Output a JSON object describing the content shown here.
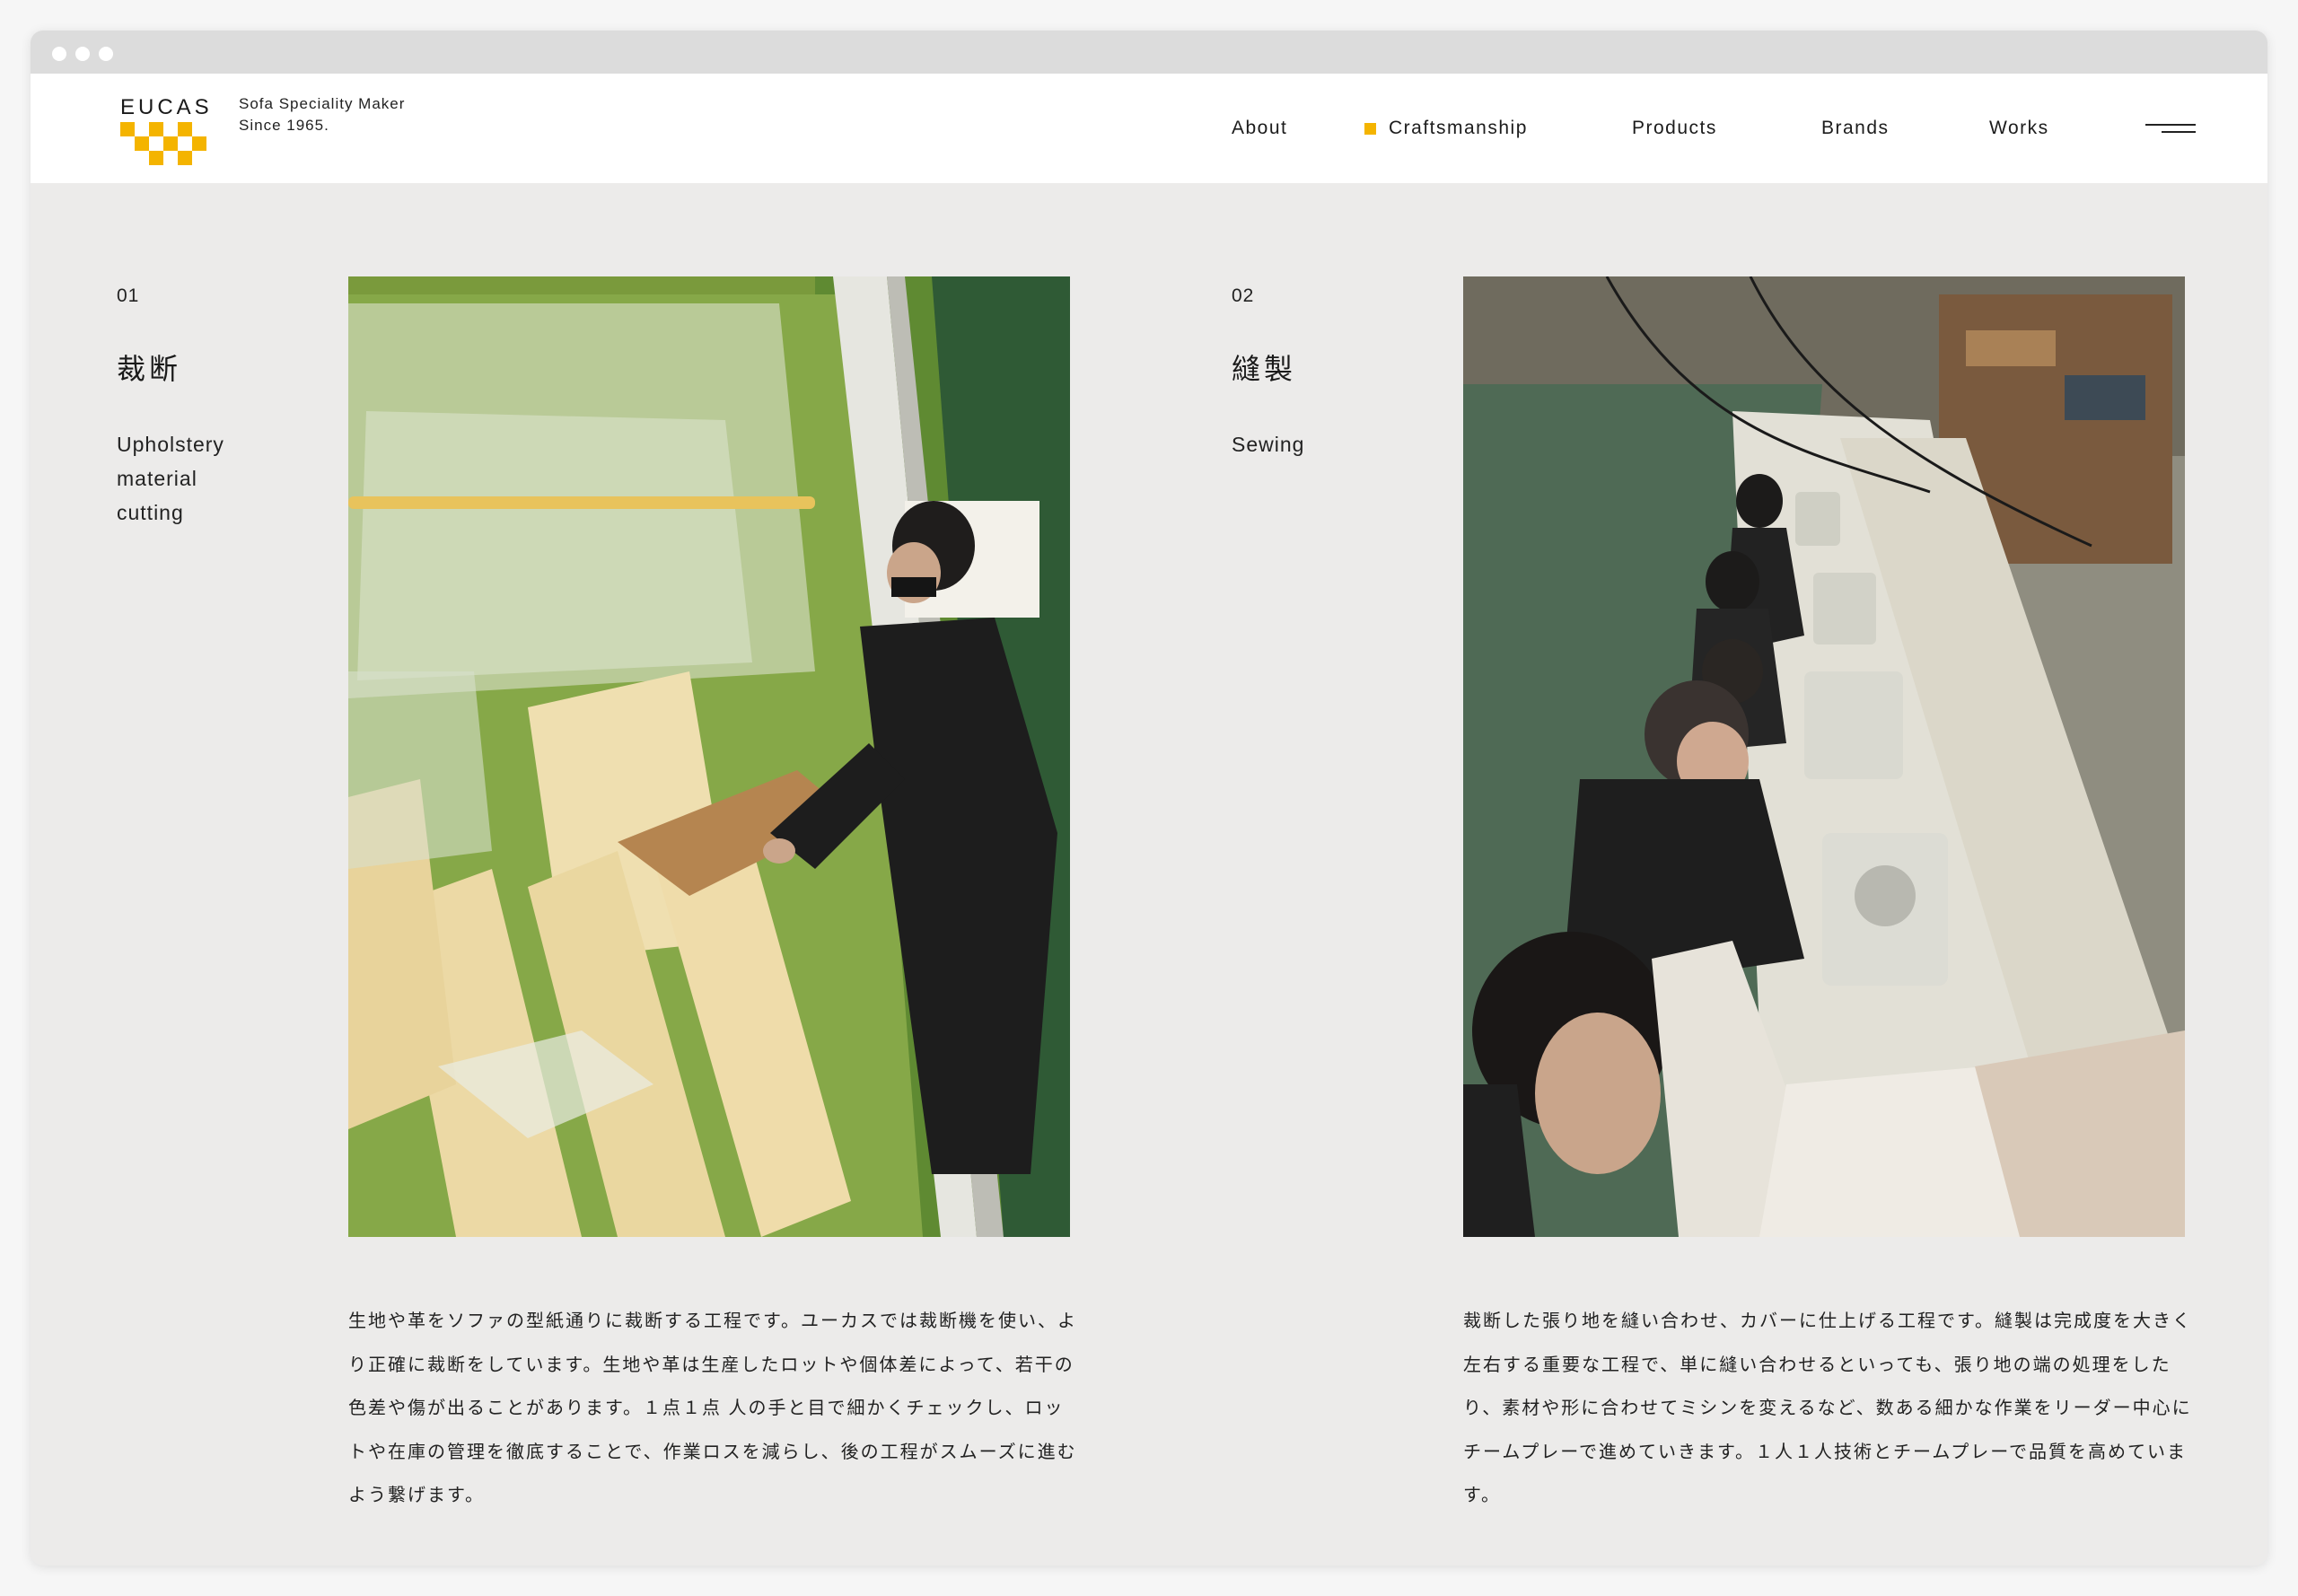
{
  "brand": {
    "logo_text": "EUCAS",
    "tagline_line1": "Sofa Speciality Maker",
    "tagline_line2": "Since 1965.",
    "accent": "#f4b400"
  },
  "nav": {
    "items": [
      {
        "label": "About",
        "active": false
      },
      {
        "label": "Craftsmanship",
        "active": true
      },
      {
        "label": "Products",
        "active": false
      },
      {
        "label": "Brands",
        "active": false
      },
      {
        "label": "Works",
        "active": false
      }
    ],
    "menu_icon": "hamburger-menu-icon"
  },
  "steps": [
    {
      "number": "01",
      "title_jp": "裁断",
      "title_en_lines": [
        "Upholstery",
        "material",
        "cutting"
      ],
      "description": "生地や革をソファの型紙通りに裁断する工程です。ユーカスでは裁断機を使い、より正確に裁断をしています。生地や革は生産したロットや個体差によって、若干の色差や傷が出ることがあります。１点１点 人の手と目で細かくチェックし、ロットや在庫の管理を徹底することで、作業ロスを減らし、後の工程がスムーズに進むよう繋げます。"
    },
    {
      "number": "02",
      "title_jp": "縫製",
      "title_en_lines": [
        "Sewing"
      ],
      "description": "裁断した張り地を縫い合わせ、カバーに仕上げる工程です。縫製は完成度を大きく左右する重要な工程で、単に縫い合わせるといっても、張り地の端の処理をしたり、素材や形に合わせてミシンを変えるなど、数ある細かな作業をリーダー中心にチームプレーで進めていきます。１人１人技術とチームプレーで品質を高めています。"
    }
  ]
}
